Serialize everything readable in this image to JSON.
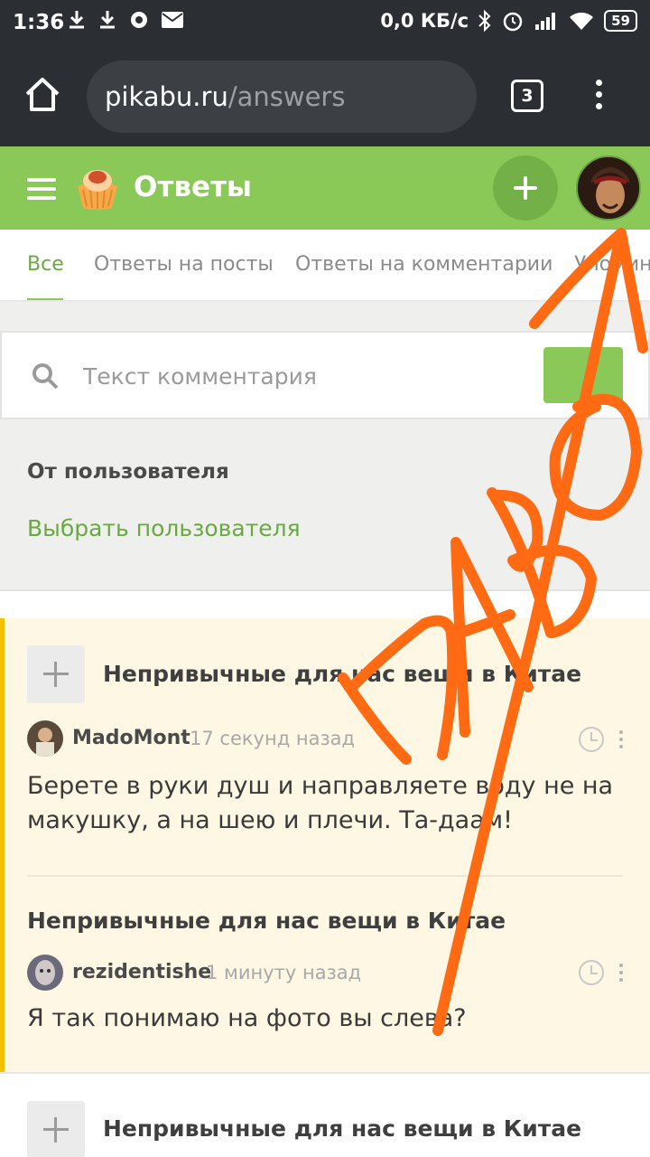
{
  "status_bar": {
    "time": "1:36",
    "net_speed": "0,0 КБ/с",
    "battery": "59"
  },
  "browser": {
    "url_host": "pikabu.ru",
    "url_path": "/answers",
    "tab_count": "3"
  },
  "header": {
    "title": "Ответы"
  },
  "tabs": [
    {
      "label": "Все",
      "active": true
    },
    {
      "label": "Ответы на посты",
      "active": false
    },
    {
      "label": "Ответы на комментарии",
      "active": false
    },
    {
      "label": "Упомин",
      "active": false
    }
  ],
  "filters": {
    "search_placeholder": "Текст комментария",
    "from_user_label": "От пользователя",
    "choose_user_link": "Выбрать пользователя"
  },
  "answers": [
    {
      "post_title": "Непривычные для нас вещи в Китае",
      "username": "MadoMont",
      "time": "17 секунд назад",
      "text": "Берете в руки душ и направляете воду не на макушку, а на шею и плечи. Та-даам!"
    },
    {
      "post_title": "Непривычные для нас вещи в Китае",
      "username": "rezidentishe",
      "time": "1 минуту назад",
      "text": "Я так понимаю на фото вы слева?"
    },
    {
      "post_title": "Непривычные для нас вещи в Китае"
    }
  ],
  "overlay": {
    "handwriting": "ПАВО",
    "color": "#ff6a13"
  },
  "colors": {
    "brand_green": "#8ac858",
    "accent_yellow": "#f2c400",
    "highlight_bg": "#fdf7e3"
  },
  "icons": [
    "download-icon",
    "bluetooth-icon",
    "alarm-icon",
    "signal-icon",
    "wifi-icon",
    "home-icon",
    "search-icon",
    "clock-icon",
    "more-icon"
  ]
}
